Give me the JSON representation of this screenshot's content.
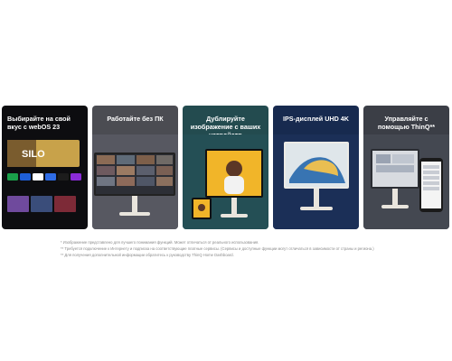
{
  "cards": [
    {
      "title": "Выбирайте на свой вкус с webOS 23",
      "silo_text": "SILO"
    },
    {
      "title": "Работайте без ПК"
    },
    {
      "title": "Дублируйте изображение с ваших устройств"
    },
    {
      "title": "IPS-дисплей UHD 4K"
    },
    {
      "title": "Управляйте с помощью ThinQ**"
    }
  ],
  "footnotes": [
    "* Изображение представлено для лучшего понимания функций. Может отличаться от реального использования.",
    "** Требуется подключение к Интернету и подписка на соответствующие платные сервисы. (Сервисы и доступные функции могут отличаться в зависимости от страны и региона.)",
    "** Для получения дополнительной информации обратитесь к руководству ThinQ Home Dashboard."
  ],
  "colors": {
    "card1_bg": "#0d0d10",
    "card2_bg": "#4b4c52",
    "card3_bg": "#234b4f",
    "card4_bg": "#172a4f",
    "card5_bg": "#3b3e46",
    "footnote_text": "#8a8a8a"
  }
}
